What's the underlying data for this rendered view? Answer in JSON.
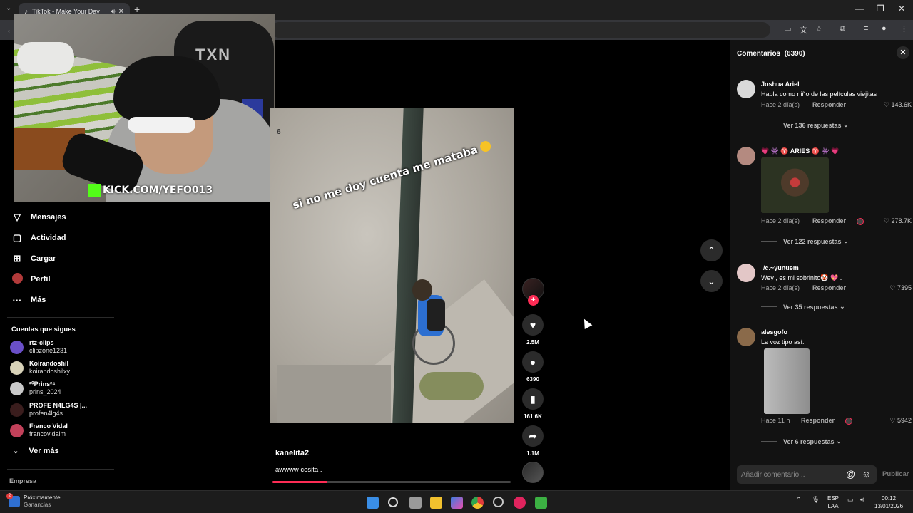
{
  "browser": {
    "tab_title": "TikTok - Make Your Day",
    "new_tab": "+"
  },
  "webcam": {
    "chair_logo": "TXN",
    "overlay_text": "KICK.COM/YEFO013"
  },
  "sidebar": {
    "nav": [
      {
        "label": "Mensajes",
        "icon": "send-icon"
      },
      {
        "label": "Actividad",
        "icon": "inbox-icon"
      },
      {
        "label": "Cargar",
        "icon": "upload-icon"
      },
      {
        "label": "Perfil",
        "icon": "profile-avatar"
      },
      {
        "label": "Más",
        "icon": "more-icon"
      }
    ],
    "following_heading": "Cuentas que sigues",
    "accounts": [
      {
        "name": "rtz-clips",
        "handle": "clipzone1231",
        "color": "#6a4fc8"
      },
      {
        "name": "Koirandoshil",
        "handle": "koirandoshilxy",
        "color": "#d8d2b8"
      },
      {
        "name": "²⁰Prins²⁴",
        "handle": "prins_2024",
        "color": "#c9c9c9"
      },
      {
        "name": "PROFE N4LG4S |...",
        "handle": "profen4lg4s",
        "color": "#3a1d1d"
      },
      {
        "name": "Franco Vidal",
        "handle": "francovidalm",
        "color": "#c2415a"
      }
    ],
    "see_more": "Ver más",
    "footer": "Empresa"
  },
  "video": {
    "caption": "si no me doy cuenta me mataba",
    "corner_number": "6",
    "author": "kanelita2",
    "description": "awwww cosita .",
    "progress_fraction": 0.23
  },
  "actions": {
    "likes": "2.5M",
    "comments": "6390",
    "saves": "161.6K",
    "shares": "1.1M"
  },
  "comments_panel": {
    "title": "Comentarios",
    "count": "(6390)",
    "input_placeholder": "Añadir comentario...",
    "post_label": "Publicar",
    "comments": [
      {
        "user": "Joshua Ariel",
        "text": "Habla como niño de las películas viejitas",
        "time": "Hace 2 día(s)",
        "reply": "Responder",
        "likes": "143.6K",
        "more": "Ver 136 respuestas",
        "avatar": "#d9d9d9"
      },
      {
        "user": "💗 👾 ♈ ARIES ♈ 👾 💗",
        "text": "",
        "time": "Hace 2 día(s)",
        "reply": "Responder",
        "likes": "278.7K",
        "more": "Ver 122 respuestas",
        "avatar": "#b48a80"
      },
      {
        "user": "ʾ/c.~yunuem",
        "text": "Wey , es mi sobrinito🤡 💖 .",
        "time": "Hace 2 día(s)",
        "reply": "Responder",
        "likes": "7395",
        "more": "Ver 35 respuestas",
        "avatar": "#e3c7c7"
      },
      {
        "user": "alesgofo",
        "text": "La voz tipo así:",
        "time": "Hace 11 h",
        "reply": "Responder",
        "likes": "5942",
        "more": "Ver 6 respuestas",
        "avatar": "#8a6a4a"
      }
    ]
  },
  "taskbar": {
    "weather_line1": "Próximamente",
    "weather_line2": "Ganancias",
    "badge": "2",
    "lang1": "ESP",
    "lang2": "LAA",
    "time": "00:12",
    "date": "13/01/2026"
  }
}
